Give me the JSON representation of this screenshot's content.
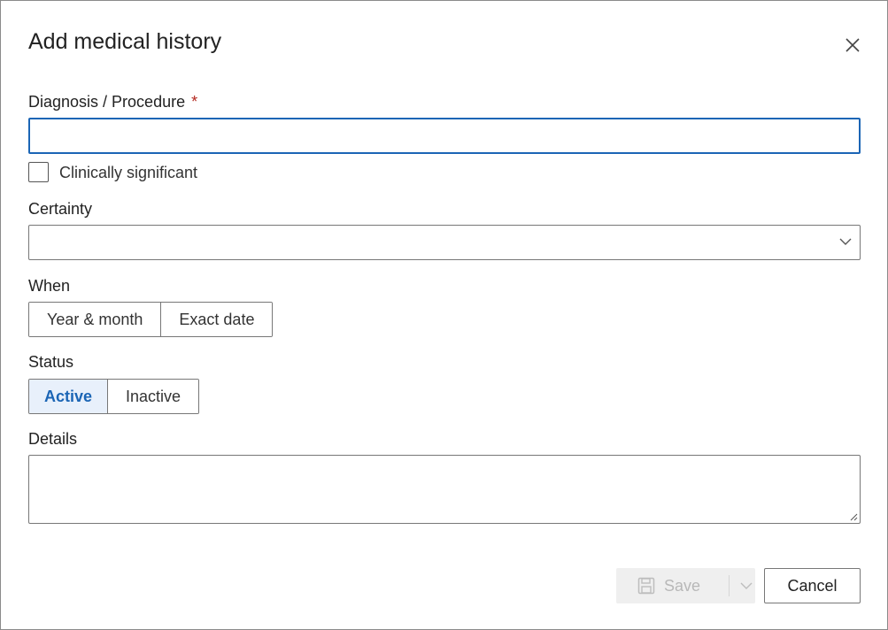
{
  "dialog": {
    "title": "Add medical history",
    "close_icon": "close-icon"
  },
  "diagnosis": {
    "label": "Diagnosis / Procedure",
    "required_marker": "*",
    "value": "",
    "placeholder": ""
  },
  "clinically_significant": {
    "label": "Clinically significant",
    "checked": false
  },
  "certainty": {
    "label": "Certainty",
    "selected": "",
    "icon": "chevron-down-icon"
  },
  "when": {
    "label": "When",
    "options": [
      "Year & month",
      "Exact date"
    ]
  },
  "status": {
    "label": "Status",
    "options": [
      "Active",
      "Inactive"
    ],
    "selected": "Active"
  },
  "details": {
    "label": "Details",
    "value": ""
  },
  "footer": {
    "save_label": "Save",
    "save_icon": "floppy-disk-icon",
    "save_dropdown_icon": "chevron-down-icon",
    "cancel_label": "Cancel"
  },
  "colors": {
    "accent": "#1b65b5",
    "required": "#b3261e",
    "active_bg": "#e8f0fb",
    "disabled_text": "#b8b8b8"
  }
}
